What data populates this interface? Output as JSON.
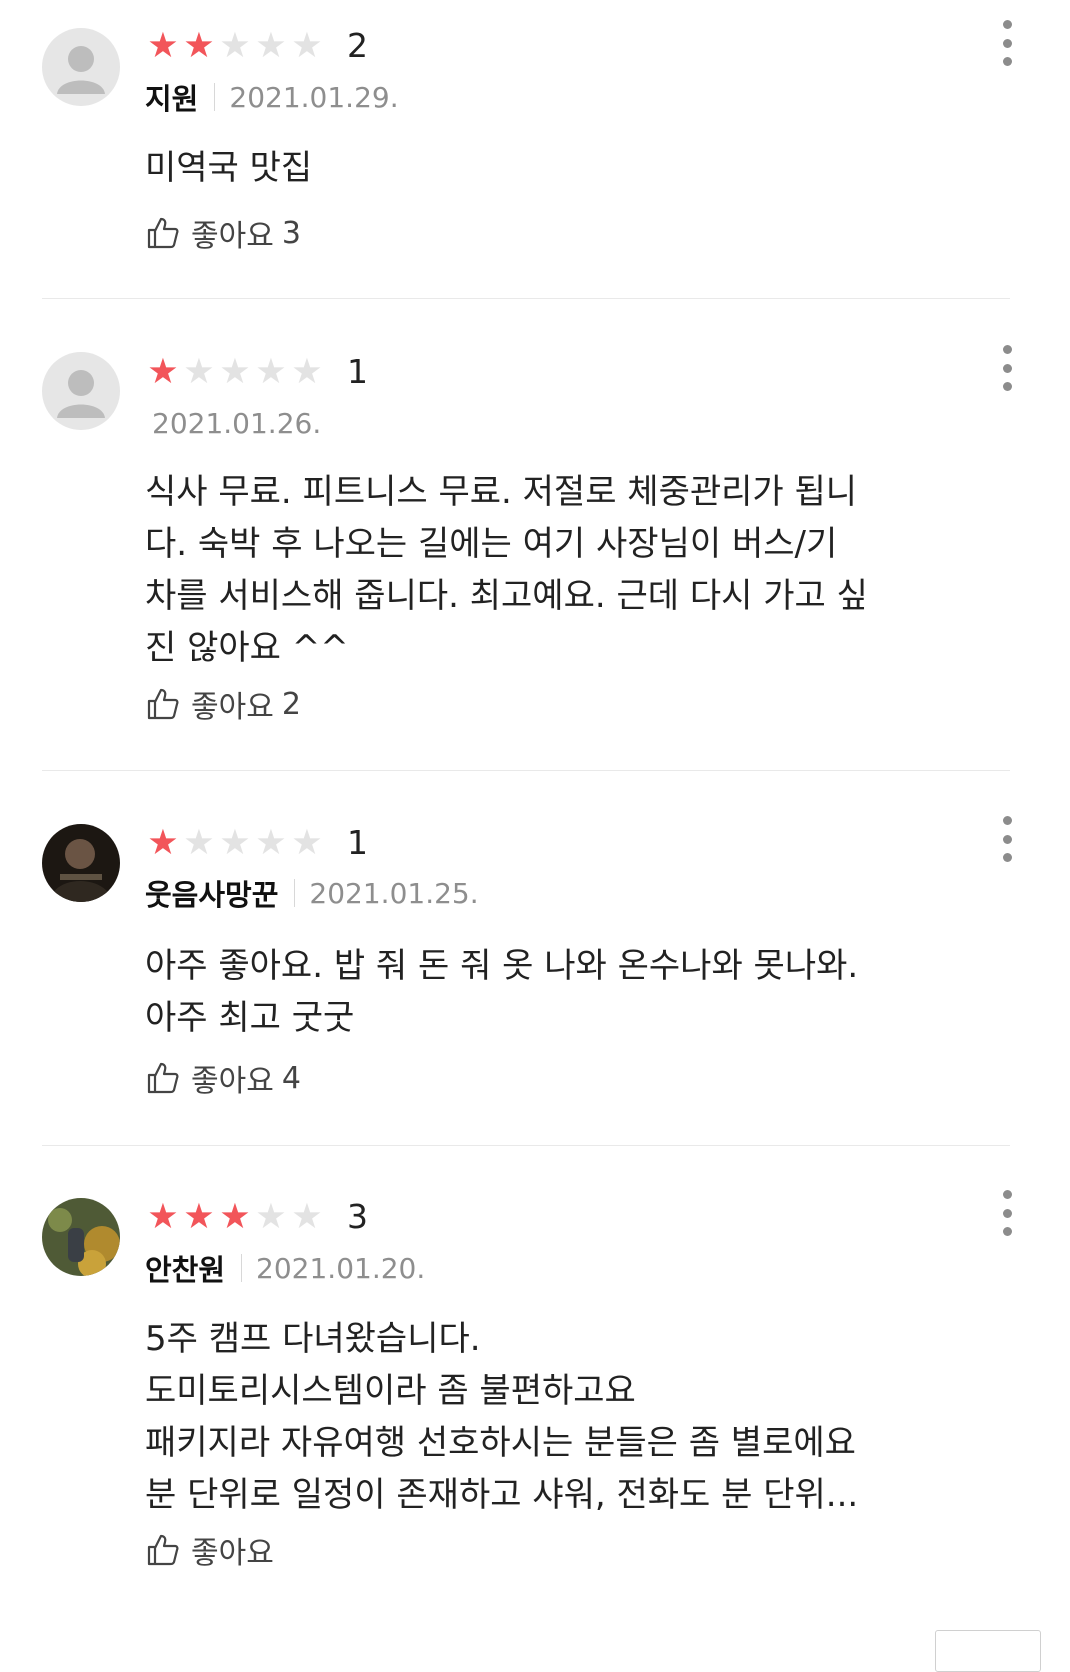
{
  "reviews": [
    {
      "avatar": "default-avatar",
      "rating": 2,
      "rating_text": "2",
      "author": "지원",
      "date": "2021.01.29.",
      "body": "미역국 맛집",
      "like_label": "좋아요",
      "like_count": "3"
    },
    {
      "avatar": "default-avatar",
      "rating": 1,
      "rating_text": "1",
      "author": "",
      "date": "2021.01.26.",
      "body": "식사 무료. 피트니스 무료. 저절로 체중관리가 됩니\n다. 숙박 후 나오는 길에는 여기 사장님이 버스/기\n차를 서비스해 줍니다. 최고예요. 근데 다시 가고 싶\n진 않아요 ^^",
      "like_label": "좋아요",
      "like_count": "2"
    },
    {
      "avatar": "photo-avatar-dark",
      "rating": 1,
      "rating_text": "1",
      "author": "웃음사망꾼",
      "date": "2021.01.25.",
      "body": "아주 좋아요. 밥 줘 돈 줘 옷 나와 온수나와 못나와.\n아주 최고 굿굿",
      "like_label": "좋아요",
      "like_count": "4"
    },
    {
      "avatar": "photo-avatar-outdoor",
      "rating": 3,
      "rating_text": "3",
      "author": "안찬원",
      "date": "2021.01.20.",
      "body": "5주 캠프 다녀왔습니다.\n도미토리시스템이라 좀 불편하고요\n패키지라 자유여행 선호하시는 분들은 좀 별로에요\n분 단위로 일정이 존재하고 샤워, 전화도 분 단위...",
      "like_label": "좋아요",
      "like_count": ""
    }
  ],
  "colors": {
    "star_on": "#f2555a",
    "star_off": "#e3e3e3",
    "date": "#8e8e8e",
    "separator": "#e9e9e9"
  }
}
